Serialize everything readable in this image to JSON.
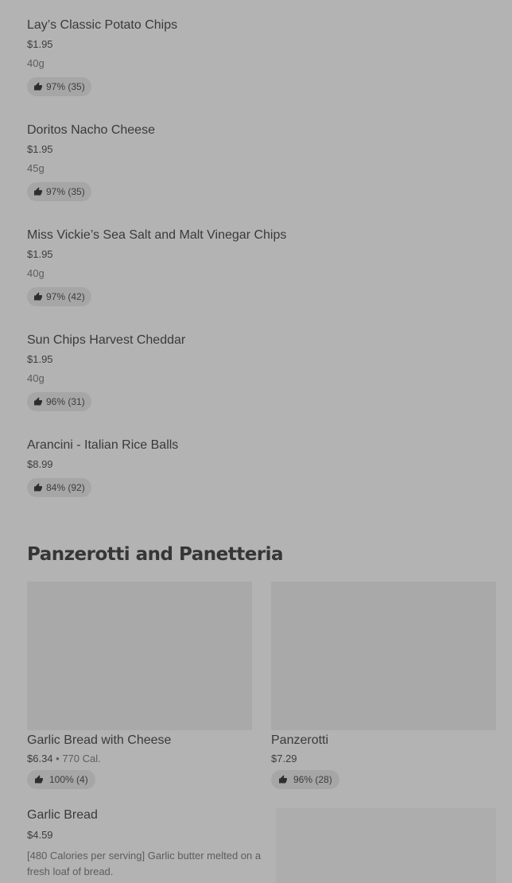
{
  "items": [
    {
      "name": "Lay’s Classic Potato Chips",
      "price": "$1.95",
      "weight": "40g",
      "rating": "97% (35)"
    },
    {
      "name": "Doritos Nacho Cheese",
      "price": "$1.95",
      "weight": "45g",
      "rating": "97% (35)"
    },
    {
      "name": "Miss Vickie’s Sea Salt and Malt Vinegar Chips",
      "price": "$1.95",
      "weight": "40g",
      "rating": "97% (42)"
    },
    {
      "name": "Sun Chips Harvest Cheddar",
      "price": "$1.95",
      "weight": "40g",
      "rating": "96% (31)"
    },
    {
      "name": "Arancini - Italian Rice Balls",
      "price": "$8.99",
      "rating": "84% (92)"
    }
  ],
  "section": {
    "title": "Panzerotti and Panetteria",
    "cards": [
      {
        "name": "Garlic Bread with Cheese",
        "price": "$6.34",
        "separator": " • ",
        "calories": "770 Cal.",
        "rating": "100% (4)"
      },
      {
        "name": "Panzerotti",
        "price": "$7.29",
        "rating": "96% (28)"
      }
    ],
    "list_item": {
      "name": "Garlic Bread",
      "price": "$4.59",
      "description": "[480 Calories per serving] Garlic butter melted on a fresh loaf of bread."
    }
  },
  "icons": {
    "rating": "thumbs-up-icon"
  },
  "colors": {
    "background": "#b3b3b3",
    "badge": "#a6a6a6",
    "image_placeholder": "#a9a9a9"
  }
}
